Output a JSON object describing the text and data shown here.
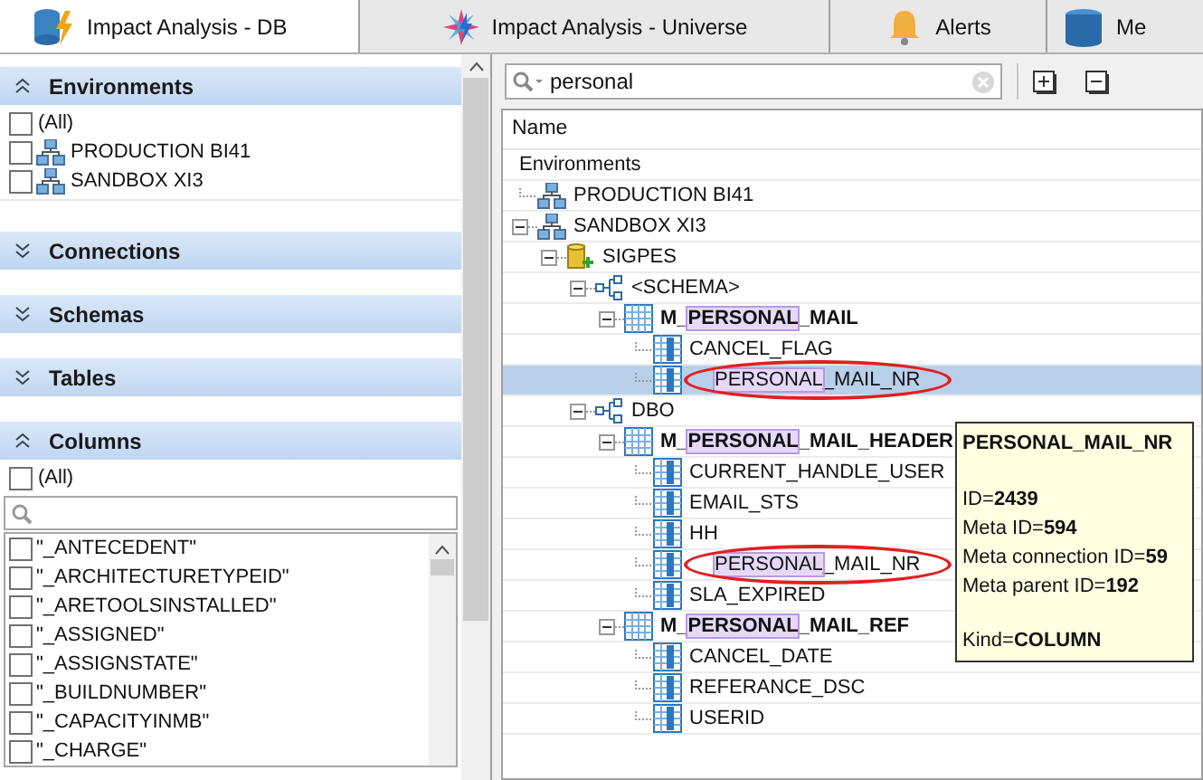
{
  "tabs": [
    {
      "label": "Impact Analysis - DB",
      "selected": true
    },
    {
      "label": "Impact Analysis - Universe",
      "selected": false
    },
    {
      "label": "Alerts",
      "selected": false
    },
    {
      "label": "Me",
      "selected": false
    }
  ],
  "filter_panel": {
    "sections": [
      {
        "title": "Environments",
        "expanded": true,
        "items": [
          {
            "label": "(All)",
            "checked": false,
            "kind": "all"
          },
          {
            "label": "PRODUCTION BI41",
            "checked": false,
            "kind": "environment"
          },
          {
            "label": "SANDBOX XI3",
            "checked": false,
            "kind": "environment"
          }
        ]
      },
      {
        "title": "Connections",
        "expanded": false
      },
      {
        "title": "Schemas",
        "expanded": false
      },
      {
        "title": "Tables",
        "expanded": false
      },
      {
        "title": "Columns",
        "expanded": true,
        "items": [
          {
            "label": "(All)",
            "checked": false,
            "kind": "all"
          }
        ],
        "search": true,
        "list": [
          {
            "label": "\"_ANTECEDENT\"",
            "checked": false
          },
          {
            "label": "\"_ARCHITECTURETYPEID\"",
            "checked": false
          },
          {
            "label": "\"_ARETOOLSINSTALLED\"",
            "checked": false
          },
          {
            "label": "\"_ASSIGNED\"",
            "checked": false
          },
          {
            "label": "\"_ASSIGNSTATE\"",
            "checked": false
          },
          {
            "label": "\"_BUILDNUMBER\"",
            "checked": false
          },
          {
            "label": "\"_CAPACITYINMB\"",
            "checked": false
          },
          {
            "label": "\"_CHARGE\"",
            "checked": false
          }
        ]
      }
    ]
  },
  "search": {
    "value": "personal"
  },
  "tree": {
    "column_header": "Name",
    "nodes": [
      {
        "parts": [
          {
            "text": "Environments",
            "match": false
          }
        ],
        "selected": false,
        "circled": false,
        "children": [
          {
            "kind": "environment",
            "parts": [
              {
                "text": "PRODUCTION BI41",
                "match": false
              }
            ],
            "selected": false,
            "circled": false
          },
          {
            "kind": "environment",
            "parts": [
              {
                "text": "SANDBOX XI3",
                "match": false
              }
            ],
            "selected": false,
            "circled": false,
            "expanded": true,
            "children": [
              {
                "kind": "database",
                "parts": [
                  {
                    "text": "SIGPES",
                    "match": false
                  }
                ],
                "selected": false,
                "circled": false,
                "expanded": true,
                "children": [
                  {
                    "kind": "schema",
                    "parts": [
                      {
                        "text": "<SCHEMA>",
                        "match": false
                      }
                    ],
                    "selected": false,
                    "circled": false,
                    "expanded": true,
                    "children": [
                      {
                        "kind": "table",
                        "parts": [
                          {
                            "text": "M_",
                            "match": false
                          },
                          {
                            "text": "PERSONAL",
                            "match": true
                          },
                          {
                            "text": "_MAIL",
                            "match": false
                          }
                        ],
                        "selected": false,
                        "circled": false,
                        "expanded": true,
                        "children": [
                          {
                            "kind": "column",
                            "parts": [
                              {
                                "text": "CANCEL_FLAG",
                                "match": false
                              }
                            ],
                            "selected": false,
                            "circled": false
                          },
                          {
                            "kind": "column",
                            "parts": [
                              {
                                "text": "PERSONAL",
                                "match": true
                              },
                              {
                                "text": "_MAIL_NR",
                                "match": false
                              }
                            ],
                            "selected": true,
                            "circled": true
                          }
                        ]
                      }
                    ]
                  },
                  {
                    "kind": "schema",
                    "parts": [
                      {
                        "text": "DBO",
                        "match": false
                      }
                    ],
                    "selected": false,
                    "circled": false,
                    "expanded": true,
                    "children": [
                      {
                        "kind": "table",
                        "parts": [
                          {
                            "text": "M_",
                            "match": false
                          },
                          {
                            "text": "PERSONAL",
                            "match": true
                          },
                          {
                            "text": "_MAIL_HEADER",
                            "match": false
                          }
                        ],
                        "selected": false,
                        "circled": false,
                        "expanded": true,
                        "children": [
                          {
                            "kind": "column",
                            "parts": [
                              {
                                "text": "CURRENT_HANDLE_USER",
                                "match": false
                              }
                            ],
                            "selected": false,
                            "circled": false
                          },
                          {
                            "kind": "column",
                            "parts": [
                              {
                                "text": "EMAIL_STS",
                                "match": false
                              }
                            ],
                            "selected": false,
                            "circled": false
                          },
                          {
                            "kind": "column",
                            "parts": [
                              {
                                "text": "HH",
                                "match": false
                              }
                            ],
                            "selected": false,
                            "circled": false
                          },
                          {
                            "kind": "column",
                            "parts": [
                              {
                                "text": "PERSONAL",
                                "match": true
                              },
                              {
                                "text": "_MAIL_NR",
                                "match": false
                              }
                            ],
                            "selected": false,
                            "circled": true
                          },
                          {
                            "kind": "column",
                            "parts": [
                              {
                                "text": "SLA_EXPIRED",
                                "match": false
                              }
                            ],
                            "selected": false,
                            "circled": false
                          }
                        ]
                      },
                      {
                        "kind": "table",
                        "parts": [
                          {
                            "text": "M_",
                            "match": false
                          },
                          {
                            "text": "PERSONAL",
                            "match": true
                          },
                          {
                            "text": "_MAIL_REF",
                            "match": false
                          }
                        ],
                        "selected": false,
                        "circled": false,
                        "expanded": true,
                        "children": [
                          {
                            "kind": "column",
                            "parts": [
                              {
                                "text": "CANCEL_DATE",
                                "match": false
                              }
                            ],
                            "selected": false,
                            "circled": false
                          },
                          {
                            "kind": "column",
                            "parts": [
                              {
                                "text": "REFERANCE_DSC",
                                "match": false
                              }
                            ],
                            "selected": false,
                            "circled": false
                          },
                          {
                            "kind": "column",
                            "parts": [
                              {
                                "text": "USERID",
                                "match": false
                              }
                            ],
                            "selected": false,
                            "circled": false
                          }
                        ]
                      }
                    ]
                  }
                ]
              }
            ]
          }
        ]
      }
    ]
  },
  "tooltip": {
    "title": "PERSONAL_MAIL_NR",
    "groups": [
      [
        "ID=**2439**",
        "Meta ID=**594**",
        "Meta connection ID=**59**",
        "Meta parent ID=**192**"
      ],
      [
        "Kind=**COLUMN**"
      ]
    ]
  }
}
